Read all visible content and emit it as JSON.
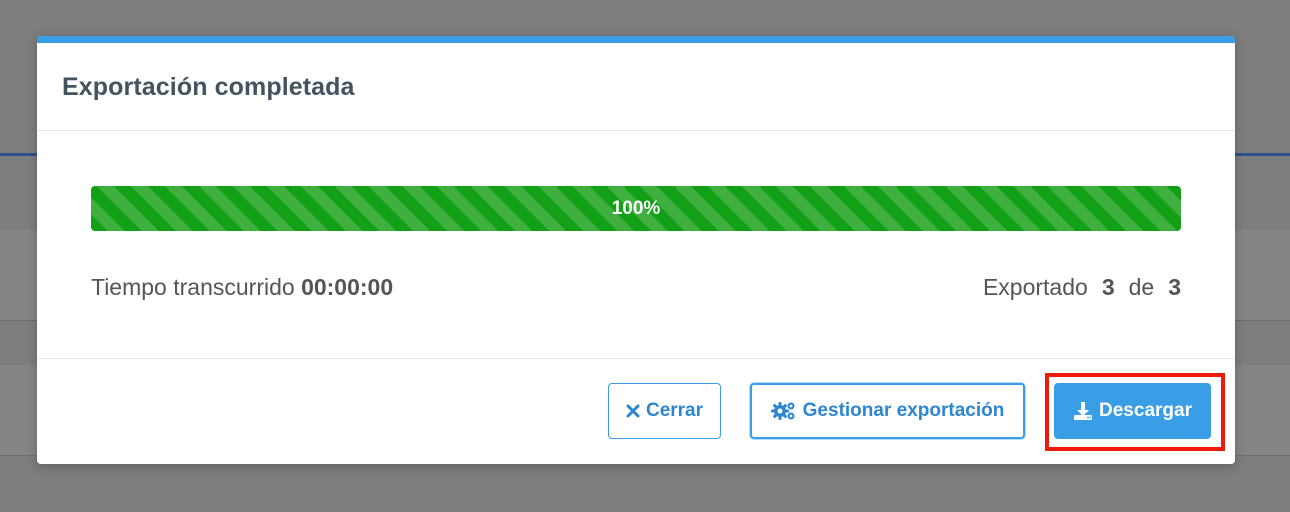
{
  "modal": {
    "title": "Exportación completada",
    "progress": {
      "percent": 100,
      "label": "100%"
    },
    "elapsed": {
      "label": "Tiempo transcurrido",
      "value": "00:00:00"
    },
    "exported": {
      "label": "Exportado",
      "count": "3",
      "separator": "de",
      "total": "3"
    },
    "buttons": {
      "close_label": "Cerrar",
      "manage_label": "Gestionar exportación",
      "download_label": "Descargar"
    }
  },
  "colors": {
    "accent": "#3a9ee6",
    "progress_green": "#19a11f",
    "highlight_red": "#f01a0a",
    "title_text": "#44545f"
  },
  "icons": {
    "close": "close-icon",
    "manage": "gears-icon",
    "download": "download-icon"
  }
}
